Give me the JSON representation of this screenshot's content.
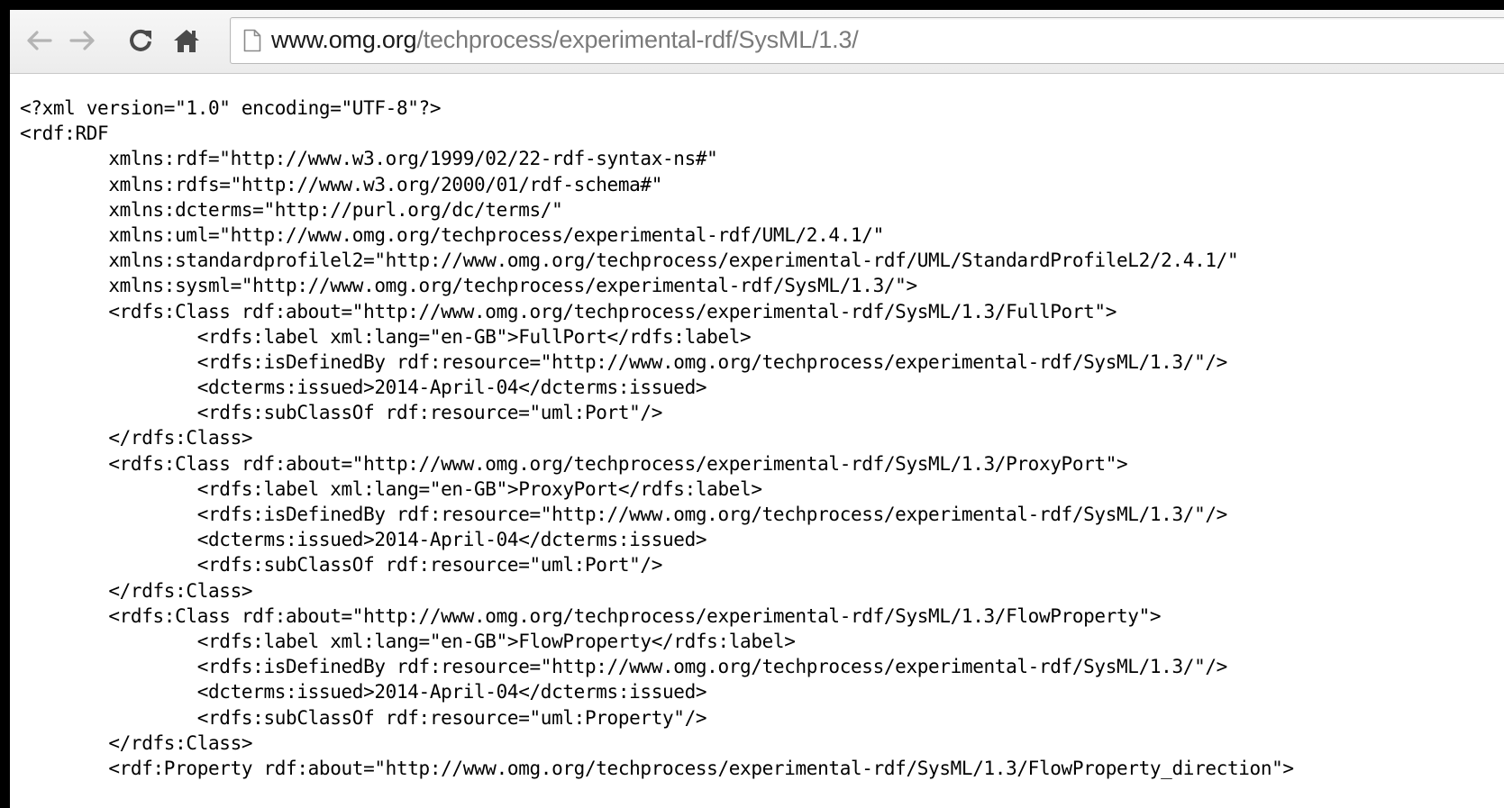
{
  "browser": {
    "url_host": "www.omg.org",
    "url_path": "/techprocess/experimental-rdf/SysML/1.3/",
    "buttons": {
      "back": "back-arrow-icon",
      "forward": "forward-arrow-icon",
      "reload": "reload-icon",
      "home": "home-icon"
    }
  },
  "document": {
    "lines": [
      {
        "indent": 0,
        "text": "<?xml version=\"1.0\" encoding=\"UTF-8\"?>"
      },
      {
        "indent": 0,
        "text": "<rdf:RDF"
      },
      {
        "indent": 1,
        "text": "xmlns:rdf=\"http://www.w3.org/1999/02/22-rdf-syntax-ns#\""
      },
      {
        "indent": 1,
        "text": "xmlns:rdfs=\"http://www.w3.org/2000/01/rdf-schema#\""
      },
      {
        "indent": 1,
        "text": "xmlns:dcterms=\"http://purl.org/dc/terms/\""
      },
      {
        "indent": 1,
        "text": "xmlns:uml=\"http://www.omg.org/techprocess/experimental-rdf/UML/2.4.1/\""
      },
      {
        "indent": 1,
        "text": "xmlns:standardprofilel2=\"http://www.omg.org/techprocess/experimental-rdf/UML/StandardProfileL2/2.4.1/\""
      },
      {
        "indent": 1,
        "text": "xmlns:sysml=\"http://www.omg.org/techprocess/experimental-rdf/SysML/1.3/\">"
      },
      {
        "indent": 1,
        "text": "<rdfs:Class rdf:about=\"http://www.omg.org/techprocess/experimental-rdf/SysML/1.3/FullPort\">"
      },
      {
        "indent": 2,
        "text": "<rdfs:label xml:lang=\"en-GB\">FullPort</rdfs:label>"
      },
      {
        "indent": 2,
        "text": "<rdfs:isDefinedBy rdf:resource=\"http://www.omg.org/techprocess/experimental-rdf/SysML/1.3/\"/>"
      },
      {
        "indent": 2,
        "text": "<dcterms:issued>2014-April-04</dcterms:issued>"
      },
      {
        "indent": 2,
        "text": "<rdfs:subClassOf rdf:resource=\"uml:Port\"/>"
      },
      {
        "indent": 1,
        "text": "</rdfs:Class>"
      },
      {
        "indent": 1,
        "text": "<rdfs:Class rdf:about=\"http://www.omg.org/techprocess/experimental-rdf/SysML/1.3/ProxyPort\">"
      },
      {
        "indent": 2,
        "text": "<rdfs:label xml:lang=\"en-GB\">ProxyPort</rdfs:label>"
      },
      {
        "indent": 2,
        "text": "<rdfs:isDefinedBy rdf:resource=\"http://www.omg.org/techprocess/experimental-rdf/SysML/1.3/\"/>"
      },
      {
        "indent": 2,
        "text": "<dcterms:issued>2014-April-04</dcterms:issued>"
      },
      {
        "indent": 2,
        "text": "<rdfs:subClassOf rdf:resource=\"uml:Port\"/>"
      },
      {
        "indent": 1,
        "text": "</rdfs:Class>"
      },
      {
        "indent": 1,
        "text": "<rdfs:Class rdf:about=\"http://www.omg.org/techprocess/experimental-rdf/SysML/1.3/FlowProperty\">"
      },
      {
        "indent": 2,
        "text": "<rdfs:label xml:lang=\"en-GB\">FlowProperty</rdfs:label>"
      },
      {
        "indent": 2,
        "text": "<rdfs:isDefinedBy rdf:resource=\"http://www.omg.org/techprocess/experimental-rdf/SysML/1.3/\"/>"
      },
      {
        "indent": 2,
        "text": "<dcterms:issued>2014-April-04</dcterms:issued>"
      },
      {
        "indent": 2,
        "text": "<rdfs:subClassOf rdf:resource=\"uml:Property\"/>"
      },
      {
        "indent": 1,
        "text": "</rdfs:Class>"
      },
      {
        "indent": 1,
        "text": "<rdf:Property rdf:about=\"http://www.omg.org/techprocess/experimental-rdf/SysML/1.3/FlowProperty_direction\">"
      }
    ]
  }
}
